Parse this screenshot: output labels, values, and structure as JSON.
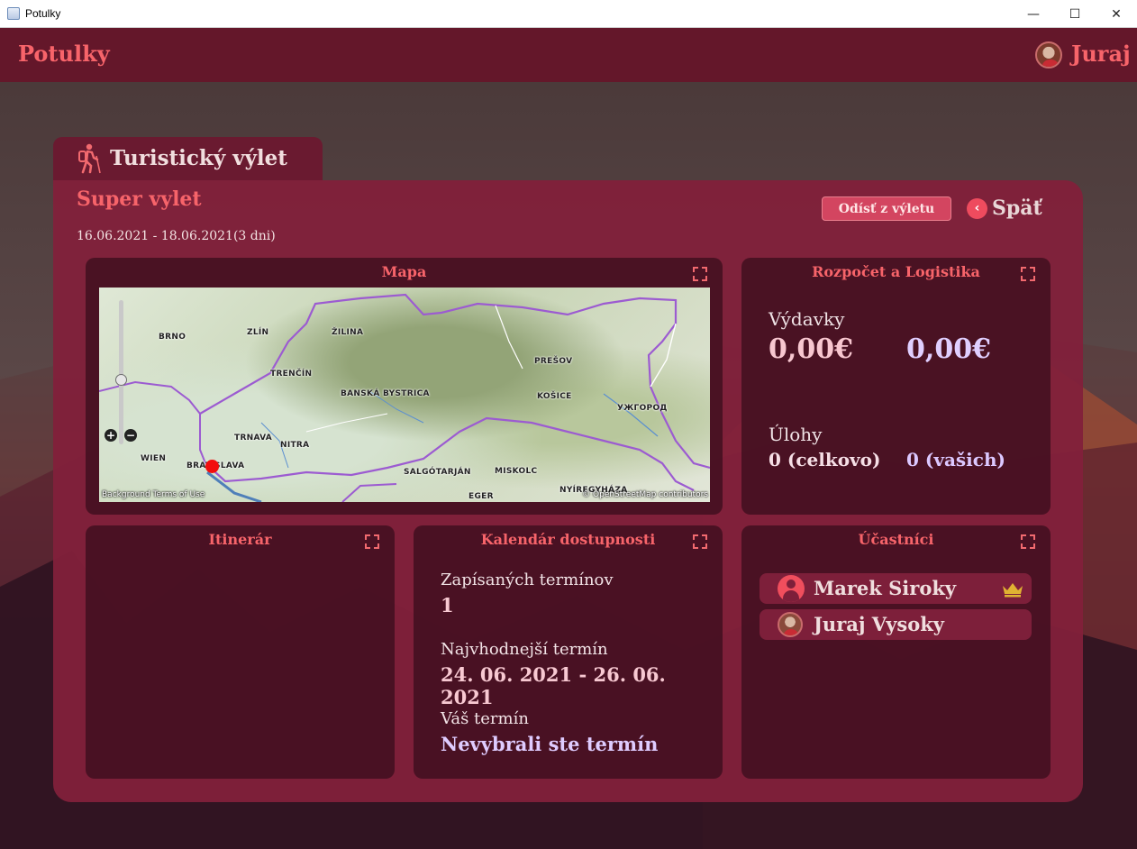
{
  "window": {
    "title": "Potulky",
    "minimize": "—",
    "maximize": "☐",
    "close": "✕"
  },
  "header": {
    "brand": "Potulky",
    "user_name": "Juraj"
  },
  "trip": {
    "type_label": "Turistický výlet",
    "name": "Super vylet",
    "dates": "16.06.2021 - 18.06.2021(3 dni)",
    "leave_label": "Odísť z výletu",
    "back_label": "Späť"
  },
  "map_panel": {
    "title": "Mapa",
    "cities": [
      {
        "id": "brno",
        "name": "BRNO"
      },
      {
        "id": "zlin",
        "name": "ZLÍN"
      },
      {
        "id": "zilina",
        "name": "ŽILINA"
      },
      {
        "id": "trencin",
        "name": "TRENČÍN"
      },
      {
        "id": "banska",
        "name": "BANSKÁ BYSTRICA"
      },
      {
        "id": "presov",
        "name": "PREŠOV"
      },
      {
        "id": "kosice",
        "name": "KOŠICE"
      },
      {
        "id": "uzhhorod",
        "name": "УЖГОРОД"
      },
      {
        "id": "trnava",
        "name": "TRNAVA"
      },
      {
        "id": "nitra",
        "name": "NITRA"
      },
      {
        "id": "wien",
        "name": "WIEN"
      },
      {
        "id": "bratislava",
        "name": "BRATISLAVA"
      },
      {
        "id": "salgotarjan",
        "name": "SALGÓTARJÁN"
      },
      {
        "id": "miskolc",
        "name": "MISKOLC"
      },
      {
        "id": "eger",
        "name": "EGER"
      },
      {
        "id": "nyiregyhaza",
        "name": "NYÍREGYHÁZA"
      }
    ],
    "attribution_left": "Background Terms of Use",
    "attribution_right": "© OpenStreetMap contributors",
    "zoom_in": "+",
    "zoom_out": "−"
  },
  "budget_panel": {
    "title": "Rozpočet a Logistika",
    "expenses_label": "Výdavky",
    "expenses_total": "0,00€",
    "expenses_yours": "0,00€",
    "tasks_label": "Úlohy",
    "tasks_total": "0 (celkovo)",
    "tasks_yours": "0 (vašich)"
  },
  "itinerary_panel": {
    "title": "Itinerár"
  },
  "calendar_panel": {
    "title": "Kalendár dostupnosti",
    "registered_label": "Zapísaných termínov",
    "registered_value": "1",
    "best_label": "Najvhodnejší termín",
    "best_value": "24. 06. 2021 - 26. 06. 2021",
    "yours_label": "Váš termín",
    "yours_value": "Nevybrali ste termín"
  },
  "participants_panel": {
    "title": "Účastníci",
    "participants": [
      {
        "name": "Marek Siroky",
        "avatar": "person-icon",
        "badge": "crown-icon"
      },
      {
        "name": "Juraj Vysoky",
        "avatar": "photo-avatar"
      }
    ]
  },
  "colors": {
    "header": "#64172a",
    "accent": "#f7646a",
    "card": "#82203a",
    "panel": "#3e0f1e",
    "button": "#d34560"
  }
}
